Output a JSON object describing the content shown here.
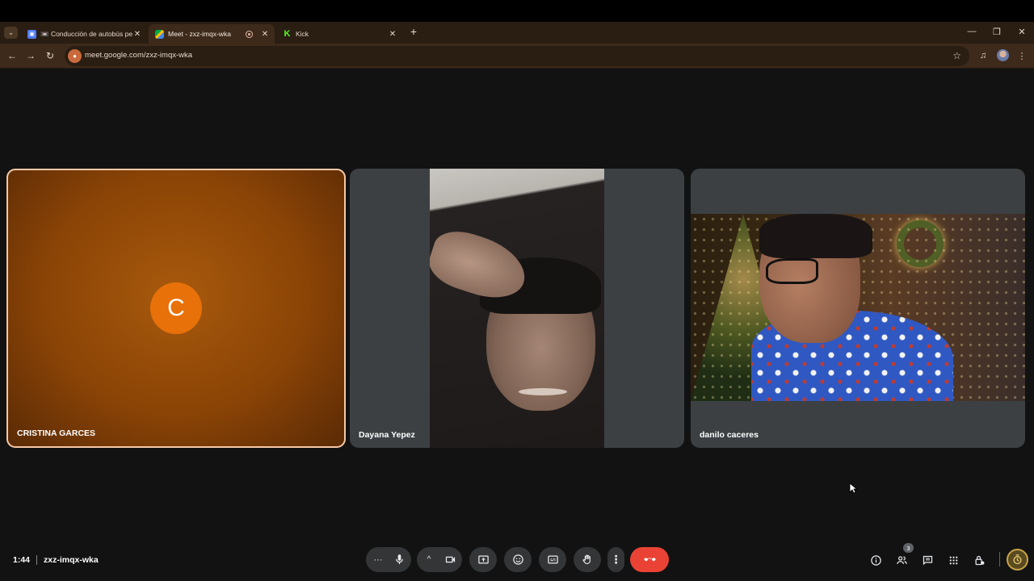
{
  "browser": {
    "tabs": [
      {
        "title": "📼 Conducción de autobús pelí",
        "favicon": "docs-icon",
        "active": false
      },
      {
        "title": "Meet - zxz-imqx-wka",
        "favicon": "meet-icon",
        "active": true,
        "recording": true
      },
      {
        "title": "Kick",
        "favicon": "kick-icon",
        "active": false
      }
    ],
    "url": "meet.google.com/zxz-imqx-wka"
  },
  "meeting": {
    "time": "1:44",
    "code": "zxz-imqx-wka",
    "participants_count": "3"
  },
  "participants": [
    {
      "name": "CRISTINA GARCES",
      "initial": "C",
      "camera_on": false,
      "active_speaker": true
    },
    {
      "name": "Dayana Yepez",
      "camera_on": true
    },
    {
      "name": "danilo caceres",
      "camera_on": true
    }
  ],
  "colors": {
    "leave_button": "#ea4335",
    "avatar": "#e8710a",
    "speaker_highlight": "#f6c9a6",
    "browser_frame": "#3d2a1b"
  }
}
